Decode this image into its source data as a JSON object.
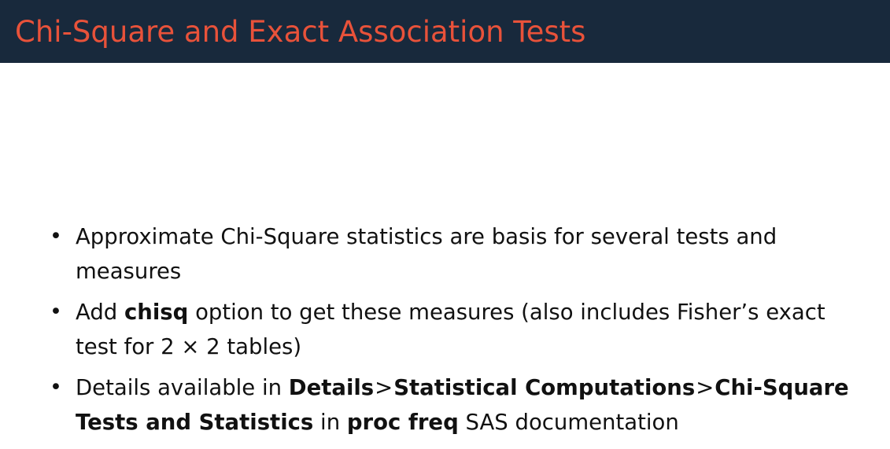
{
  "slide": {
    "title": "Chi-Square and Exact Association Tests",
    "colors": {
      "header_background": "#18293c",
      "title_text": "#e8523a",
      "body_text": "#111111"
    },
    "bullet_symbol": "•",
    "bullets": [
      {
        "text": "Approximate Chi-Square statistics are basis for several tests and measures"
      },
      {
        "prefix": "Add ",
        "strong": "chisq",
        "suffix": " option to get these measures (also includes Fisher’s exact test for 2 × 2 tables)"
      },
      {
        "prefix": "Details available in ",
        "path": [
          "Details",
          "Statistical Computations",
          "Chi-Square Tests and Statistics"
        ],
        "path_separator": ">",
        "middle": " in ",
        "strong": "proc freq",
        "suffix": " SAS documentation"
      }
    ]
  }
}
